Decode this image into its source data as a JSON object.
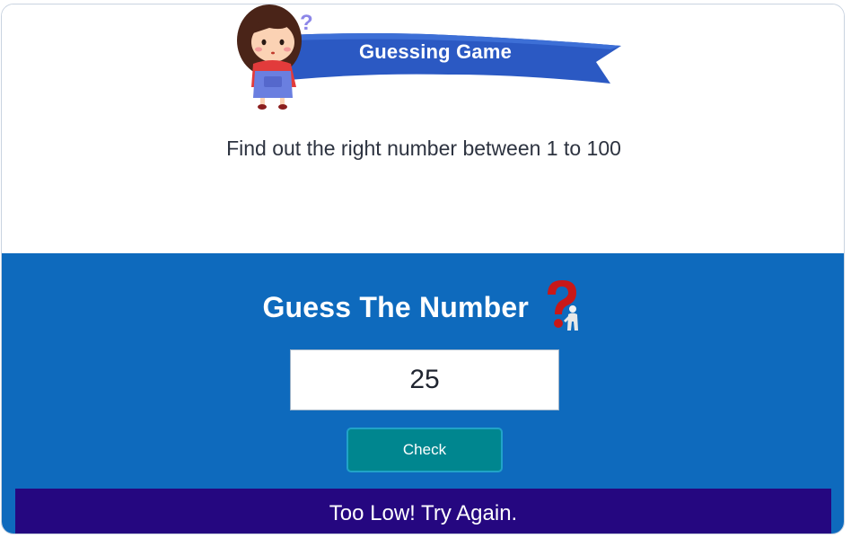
{
  "header": {
    "banner_title": "Guessing Game",
    "illustration": "girl-thinking-illustration",
    "intro_text": "Find out the right number between 1 to 100"
  },
  "game": {
    "title": "Guess The Number",
    "title_icon": "question-mark-figure-icon",
    "guess_value": "25",
    "check_label": "Check",
    "message": "Too Low! Try Again."
  },
  "colors": {
    "banner_blue": "#2b59c3",
    "game_background": "#0e6abd",
    "check_button": "#00868f",
    "message_background": "#250780"
  }
}
